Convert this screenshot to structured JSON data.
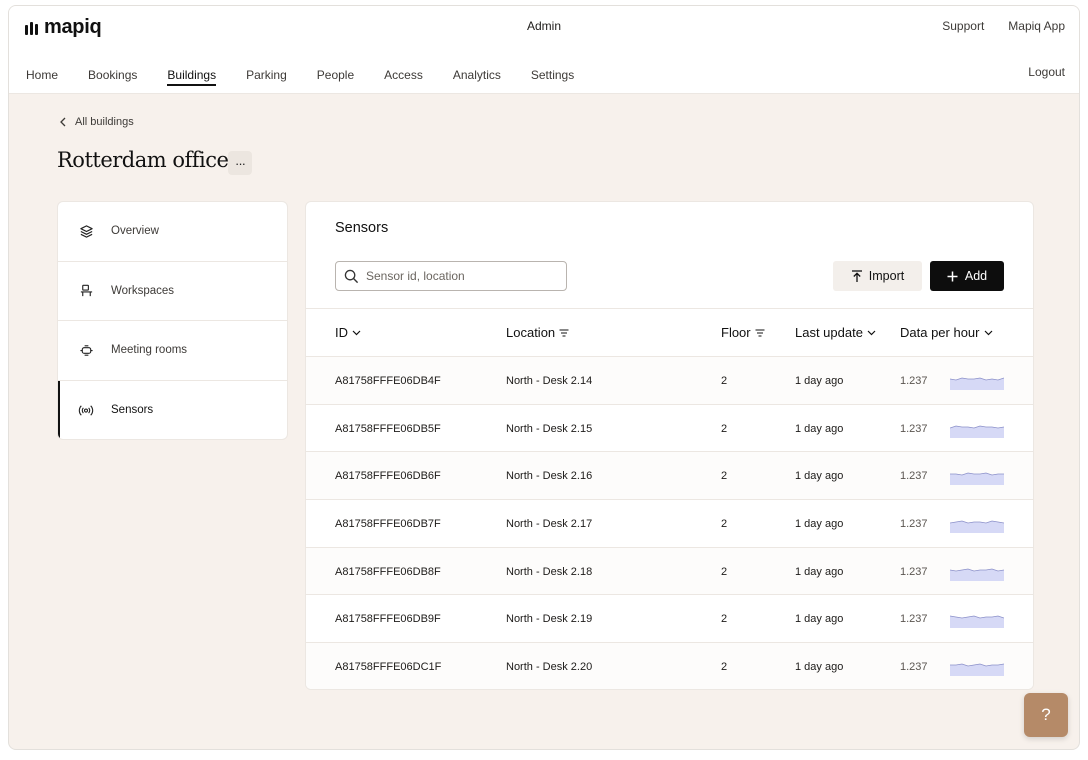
{
  "brand": {
    "name": "mapiq"
  },
  "header": {
    "center_label": "Admin",
    "links": [
      "Support",
      "Mapiq App"
    ],
    "logout": "Logout"
  },
  "nav": {
    "items": [
      "Home",
      "Bookings",
      "Buildings",
      "Parking",
      "People",
      "Access",
      "Analytics",
      "Settings"
    ],
    "active": "Buildings"
  },
  "breadcrumb": {
    "back_label": "All buildings"
  },
  "page": {
    "title": "Rotterdam office",
    "more_label": "···"
  },
  "side_menu": {
    "items": [
      {
        "label": "Overview",
        "icon": "layers-icon"
      },
      {
        "label": "Workspaces",
        "icon": "desk-icon"
      },
      {
        "label": "Meeting rooms",
        "icon": "meeting-table-icon"
      },
      {
        "label": "Sensors",
        "icon": "sensor-icon"
      }
    ],
    "active": "Sensors"
  },
  "sensors": {
    "title": "Sensors",
    "search_placeholder": "Sensor id, location",
    "import_label": "Import",
    "add_label": "Add",
    "columns": [
      "ID",
      "Location",
      "Floor",
      "Last update",
      "Data per hour"
    ],
    "rows": [
      {
        "id": "A81758FFFE06DB4F",
        "location": "North - Desk 2.14",
        "floor": "2",
        "last_update": "1 day ago",
        "data_per_hour": "1.237"
      },
      {
        "id": "A81758FFFE06DB5F",
        "location": "North - Desk 2.15",
        "floor": "2",
        "last_update": "1 day ago",
        "data_per_hour": "1.237"
      },
      {
        "id": "A81758FFFE06DB6F",
        "location": "North - Desk 2.16",
        "floor": "2",
        "last_update": "1 day ago",
        "data_per_hour": "1.237"
      },
      {
        "id": "A81758FFFE06DB7F",
        "location": "North - Desk 2.17",
        "floor": "2",
        "last_update": "1 day ago",
        "data_per_hour": "1.237"
      },
      {
        "id": "A81758FFFE06DB8F",
        "location": "North - Desk 2.18",
        "floor": "2",
        "last_update": "1 day ago",
        "data_per_hour": "1.237"
      },
      {
        "id": "A81758FFFE06DB9F",
        "location": "North - Desk 2.19",
        "floor": "2",
        "last_update": "1 day ago",
        "data_per_hour": "1.237"
      },
      {
        "id": "A81758FFFE06DC1F",
        "location": "North - Desk 2.20",
        "floor": "2",
        "last_update": "1 day ago",
        "data_per_hour": "1.237"
      }
    ]
  },
  "help": {
    "label": "?"
  },
  "colors": {
    "page_bg": "#f7f1ec",
    "accent_dark": "#0d0d0d",
    "help_button": "#b58a68",
    "sparkline_fill": "#d6d9f6",
    "sparkline_line": "#8b90c9"
  }
}
